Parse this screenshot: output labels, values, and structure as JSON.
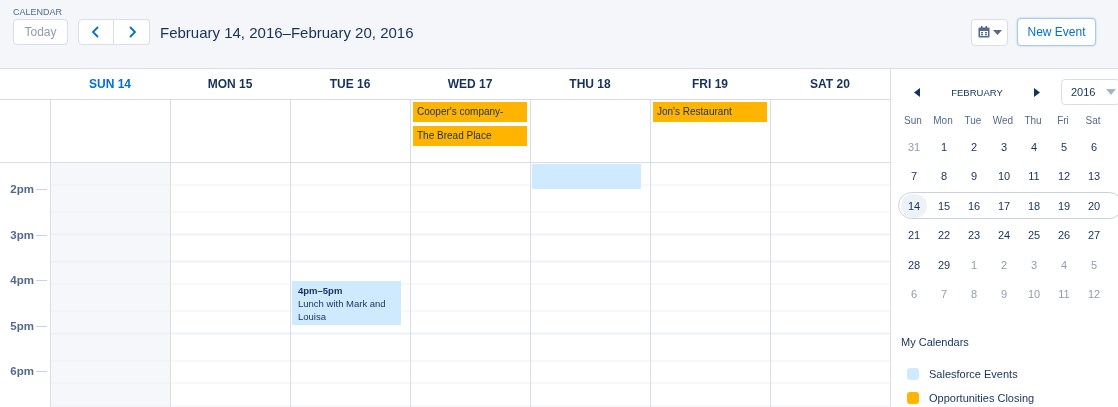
{
  "header": {
    "label": "CALENDAR",
    "today_button": {
      "label": "Today",
      "disabled": true
    },
    "range_title": "February 14, 2016–February 20, 2016",
    "new_event_button": "New Event"
  },
  "days": [
    {
      "label": "SUN 14",
      "selected": true
    },
    {
      "label": "MON 15",
      "selected": false
    },
    {
      "label": "TUE 16",
      "selected": false,
      "timed": [
        {
          "kind": "event",
          "time": "4pm–5pm",
          "title": "Lunch with Mark and Louisa",
          "color": "#cfe9fe"
        }
      ]
    },
    {
      "label": "WED 17",
      "selected": false,
      "all_day": [
        {
          "title": "Cooper's company-",
          "color": "#ffb500"
        },
        {
          "title": "The Bread Place",
          "color": "#ffb500"
        }
      ]
    },
    {
      "label": "THU 18",
      "selected": false,
      "timed": [
        {
          "kind": "continued",
          "color": "#cfe9fe"
        }
      ]
    },
    {
      "label": "FRI 19",
      "selected": false,
      "all_day": [
        {
          "title": "Jon's Restaurant",
          "color": "#ffb500"
        }
      ]
    },
    {
      "label": "SAT 20",
      "selected": false
    }
  ],
  "hours": [
    "2pm",
    "3pm",
    "4pm",
    "5pm",
    "6pm"
  ],
  "mini_calendar": {
    "month": "FEBRUARY",
    "year": "2016",
    "weekdays": [
      "Sun",
      "Mon",
      "Tue",
      "Wed",
      "Thu",
      "Fri",
      "Sat"
    ],
    "weeks": [
      {
        "selected": false,
        "days": [
          {
            "label": "31",
            "muted": true,
            "today": false
          },
          {
            "label": "1",
            "muted": false,
            "today": false
          },
          {
            "label": "2",
            "muted": false,
            "today": false
          },
          {
            "label": "3",
            "muted": false,
            "today": false
          },
          {
            "label": "4",
            "muted": false,
            "today": false
          },
          {
            "label": "5",
            "muted": false,
            "today": false
          },
          {
            "label": "6",
            "muted": false,
            "today": false
          }
        ]
      },
      {
        "selected": false,
        "days": [
          {
            "label": "7",
            "muted": false,
            "today": false
          },
          {
            "label": "8",
            "muted": false,
            "today": false
          },
          {
            "label": "9",
            "muted": false,
            "today": false
          },
          {
            "label": "10",
            "muted": false,
            "today": false
          },
          {
            "label": "11",
            "muted": false,
            "today": false
          },
          {
            "label": "12",
            "muted": false,
            "today": false
          },
          {
            "label": "13",
            "muted": false,
            "today": false
          }
        ]
      },
      {
        "selected": true,
        "days": [
          {
            "label": "14",
            "muted": false,
            "today": true
          },
          {
            "label": "15",
            "muted": false,
            "today": false
          },
          {
            "label": "16",
            "muted": false,
            "today": false
          },
          {
            "label": "17",
            "muted": false,
            "today": false
          },
          {
            "label": "18",
            "muted": false,
            "today": false
          },
          {
            "label": "19",
            "muted": false,
            "today": false
          },
          {
            "label": "20",
            "muted": false,
            "today": false
          }
        ]
      },
      {
        "selected": false,
        "days": [
          {
            "label": "21",
            "muted": false,
            "today": false
          },
          {
            "label": "22",
            "muted": false,
            "today": false
          },
          {
            "label": "23",
            "muted": false,
            "today": false
          },
          {
            "label": "24",
            "muted": false,
            "today": false
          },
          {
            "label": "25",
            "muted": false,
            "today": false
          },
          {
            "label": "26",
            "muted": false,
            "today": false
          },
          {
            "label": "27",
            "muted": false,
            "today": false
          }
        ]
      },
      {
        "selected": false,
        "days": [
          {
            "label": "28",
            "muted": false,
            "today": false
          },
          {
            "label": "29",
            "muted": false,
            "today": false
          },
          {
            "label": "1",
            "muted": true,
            "today": false
          },
          {
            "label": "2",
            "muted": true,
            "today": false
          },
          {
            "label": "3",
            "muted": true,
            "today": false
          },
          {
            "label": "4",
            "muted": true,
            "today": false
          },
          {
            "label": "5",
            "muted": true,
            "today": false
          }
        ]
      },
      {
        "selected": false,
        "days": [
          {
            "label": "6",
            "muted": true,
            "today": false
          },
          {
            "label": "7",
            "muted": true,
            "today": false
          },
          {
            "label": "8",
            "muted": true,
            "today": false
          },
          {
            "label": "9",
            "muted": true,
            "today": false
          },
          {
            "label": "10",
            "muted": true,
            "today": false
          },
          {
            "label": "11",
            "muted": true,
            "today": false
          },
          {
            "label": "12",
            "muted": true,
            "today": false
          }
        ]
      }
    ]
  },
  "my_calendars": {
    "title": "My Calendars",
    "items": [
      {
        "name": "Salesforce Events",
        "color": "#cfe9fe"
      },
      {
        "name": "Opportunities Closing",
        "color": "#ffb500"
      }
    ]
  }
}
